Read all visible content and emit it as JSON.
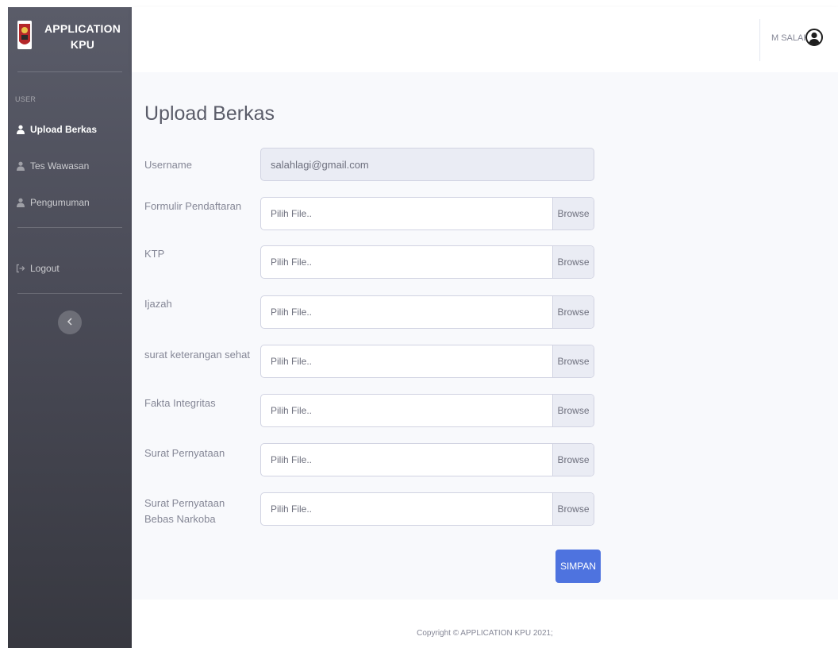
{
  "brand": {
    "line1": "APPLICATION",
    "line2": "KPU"
  },
  "sidebar": {
    "heading": "USER",
    "items": [
      {
        "label": "Upload Berkas",
        "icon": "user-icon",
        "active": true
      },
      {
        "label": "Tes Wawasan",
        "icon": "user-icon",
        "active": false
      },
      {
        "label": "Pengumuman",
        "icon": "user-icon",
        "active": false
      }
    ],
    "logout": {
      "label": "Logout",
      "icon": "sign-out-icon"
    },
    "toggle_icon": "chevron-left-icon"
  },
  "topbar": {
    "user_name": "M SALAH",
    "avatar_icon": "user-circle-icon"
  },
  "page": {
    "title": "Upload Berkas"
  },
  "form": {
    "username": {
      "label": "Username",
      "value": "salahlagi@gmail.com"
    },
    "files": [
      {
        "label": "Formulir Pendaftaran",
        "placeholder": "Pilih File..",
        "browse": "Browse"
      },
      {
        "label": "KTP",
        "placeholder": "Pilih File..",
        "browse": "Browse"
      },
      {
        "label": "Ijazah",
        "placeholder": "Pilih File..",
        "browse": "Browse"
      },
      {
        "label": "surat keterangan sehat",
        "placeholder": "Pilih File..",
        "browse": "Browse"
      },
      {
        "label": "Fakta Integritas",
        "placeholder": "Pilih File..",
        "browse": "Browse"
      },
      {
        "label": "Surat Pernyataan",
        "placeholder": "Pilih File..",
        "browse": "Browse"
      },
      {
        "label": "Surat Pernyataan Bebas Narkoba",
        "placeholder": "Pilih File..",
        "browse": "Browse"
      }
    ],
    "submit_label": "SIMPAN"
  },
  "footer": {
    "text": "Copyright © APPLICATION KPU 2021;"
  },
  "colors": {
    "sidebar": "#4a4b57",
    "primary": "#4e73df",
    "content_bg": "#f8f9fc",
    "input_border": "#d1d3e2"
  }
}
